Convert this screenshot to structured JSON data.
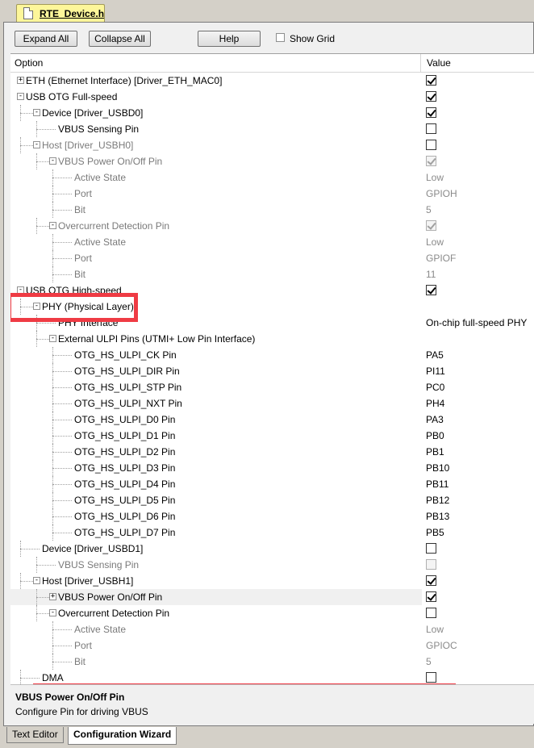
{
  "file_tab": {
    "label": "RTE_Device.h"
  },
  "toolbar": {
    "expand_all": "Expand All",
    "collapse_all": "Collapse All",
    "help": "Help",
    "show_grid": "Show Grid"
  },
  "header": {
    "option": "Option",
    "value": "Value"
  },
  "rows": [
    {
      "label": "ETH (Ethernet Interface) [Driver_ETH_MAC0]",
      "value": "checked"
    },
    {
      "label": "USB OTG Full-speed",
      "value": "checked"
    },
    {
      "label": "Device [Driver_USBD0]",
      "value": "checked"
    },
    {
      "label": "VBUS Sensing Pin",
      "value": "unchecked"
    },
    {
      "label": "Host [Driver_USBH0]",
      "value": "unchecked"
    },
    {
      "label": "VBUS Power On/Off Pin",
      "value": "checked"
    },
    {
      "label": "Active State",
      "value": "Low"
    },
    {
      "label": "Port",
      "value": "GPIOH"
    },
    {
      "label": "Bit",
      "value": "5"
    },
    {
      "label": "Overcurrent Detection Pin",
      "value": "checked"
    },
    {
      "label": "Active State",
      "value": "Low"
    },
    {
      "label": "Port",
      "value": "GPIOF"
    },
    {
      "label": "Bit",
      "value": "11"
    },
    {
      "label": "USB OTG High-speed",
      "value": "checked"
    },
    {
      "label": "PHY (Physical Layer)",
      "value": ""
    },
    {
      "label": "PHY Interface",
      "value": "On-chip full-speed PHY"
    },
    {
      "label": "External ULPI Pins (UTMI+ Low Pin Interface)",
      "value": ""
    },
    {
      "label": "OTG_HS_ULPI_CK Pin",
      "value": "PA5"
    },
    {
      "label": "OTG_HS_ULPI_DIR Pin",
      "value": "PI11"
    },
    {
      "label": "OTG_HS_ULPI_STP Pin",
      "value": "PC0"
    },
    {
      "label": "OTG_HS_ULPI_NXT Pin",
      "value": "PH4"
    },
    {
      "label": "OTG_HS_ULPI_D0 Pin",
      "value": "PA3"
    },
    {
      "label": "OTG_HS_ULPI_D1 Pin",
      "value": "PB0"
    },
    {
      "label": "OTG_HS_ULPI_D2 Pin",
      "value": "PB1"
    },
    {
      "label": "OTG_HS_ULPI_D3 Pin",
      "value": "PB10"
    },
    {
      "label": "OTG_HS_ULPI_D4 Pin",
      "value": "PB11"
    },
    {
      "label": "OTG_HS_ULPI_D5 Pin",
      "value": "PB12"
    },
    {
      "label": "OTG_HS_ULPI_D6 Pin",
      "value": "PB13"
    },
    {
      "label": "OTG_HS_ULPI_D7 Pin",
      "value": "PB5"
    },
    {
      "label": "Device [Driver_USBD1]",
      "value": "unchecked"
    },
    {
      "label": "VBUS Sensing Pin",
      "value": "unchecked"
    },
    {
      "label": "Host [Driver_USBH1]",
      "value": "checked"
    },
    {
      "label": "VBUS Power On/Off Pin",
      "value": "checked"
    },
    {
      "label": "Overcurrent Detection Pin",
      "value": "unchecked"
    },
    {
      "label": "Active State",
      "value": "Low"
    },
    {
      "label": "Port",
      "value": "GPIOC"
    },
    {
      "label": "Bit",
      "value": "5"
    },
    {
      "label": "DMA",
      "value": "unchecked"
    }
  ],
  "description": {
    "title": "VBUS Power On/Off Pin",
    "text": "Configure Pin for driving VBUS"
  },
  "bottom_tabs": [
    {
      "label": "Text Editor"
    },
    {
      "label": "Configuration Wizard"
    }
  ],
  "colors": {
    "highlight_box": "#ef3b44",
    "file_tab": "#fdf69a"
  }
}
